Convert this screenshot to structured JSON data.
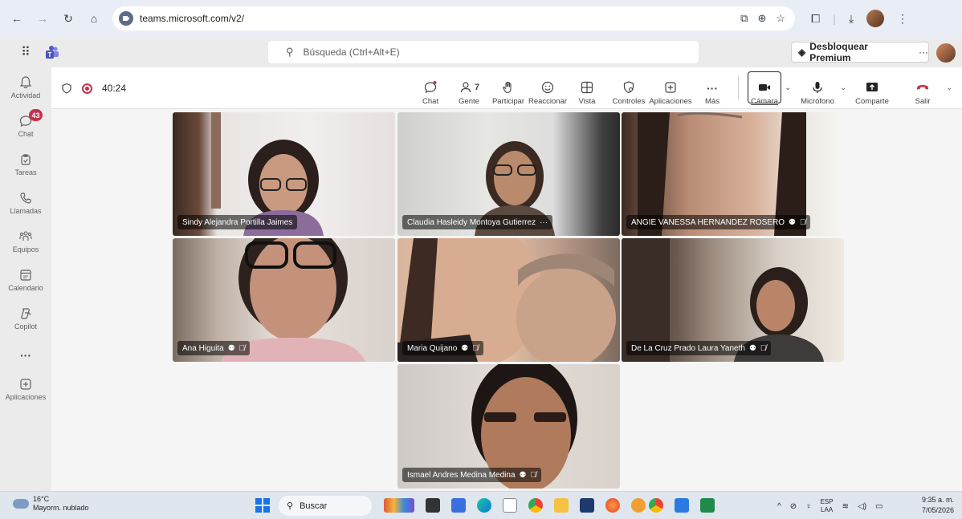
{
  "browser": {
    "url": "teams.microsoft.com/v2/"
  },
  "header": {
    "search_placeholder": "Búsqueda (Ctrl+Alt+E)",
    "premium_label": "Desbloquear Premium",
    "premium_more": "···"
  },
  "rail": {
    "items": [
      {
        "label": "Actividad",
        "icon": "bell-icon"
      },
      {
        "label": "Chat",
        "icon": "chat-icon",
        "badge": "43"
      },
      {
        "label": "Tareas",
        "icon": "tasks-icon"
      },
      {
        "label": "Llamadas",
        "icon": "phone-icon"
      },
      {
        "label": "Equipos",
        "icon": "teams-icon"
      },
      {
        "label": "Calendario",
        "icon": "calendar-icon"
      },
      {
        "label": "Copilot",
        "icon": "copilot-icon"
      },
      {
        "label": "···",
        "icon": "more-icon"
      },
      {
        "label": "Aplicaciones",
        "icon": "apps-icon"
      }
    ]
  },
  "meeting": {
    "timer": "40:24",
    "toolbar": {
      "chat": "Chat",
      "people": "Gente",
      "people_count": "7",
      "raise_hand": "Participar",
      "react": "Reaccionar",
      "view": "Vista",
      "controls": "Controles",
      "apps": "Aplicaciones",
      "more": "Más",
      "camera": "Cámara",
      "mic": "Micrófono",
      "share": "Comparte",
      "leave": "Salir"
    },
    "participants": [
      {
        "name": "Sindy Alejandra Portilla Jaimes",
        "muted": false
      },
      {
        "name": "Claudia Hasleidy Montoya Gutierrez",
        "muted": false,
        "more": "···"
      },
      {
        "name": "ANGIE VANESSA HERNANDEZ ROSERO",
        "muted": true
      },
      {
        "name": "Ana Higuita",
        "muted": true
      },
      {
        "name": "Maria Quijano",
        "muted": true
      },
      {
        "name": "De La Cruz Prado Laura Yaneth",
        "muted": true
      },
      {
        "name": "Ismael Andres Medina Medina",
        "muted": true
      }
    ]
  },
  "taskbar": {
    "temp": "16°C",
    "weather": "Mayorm. nublado",
    "search": "Buscar",
    "lang_1": "ESP",
    "lang_2": "LAA",
    "time": "9:35 a. m.",
    "date": "7/05/2026"
  },
  "colors": {
    "accent": "#5b5fc7",
    "leave": "#c4314b",
    "badge": "#c4314b"
  }
}
